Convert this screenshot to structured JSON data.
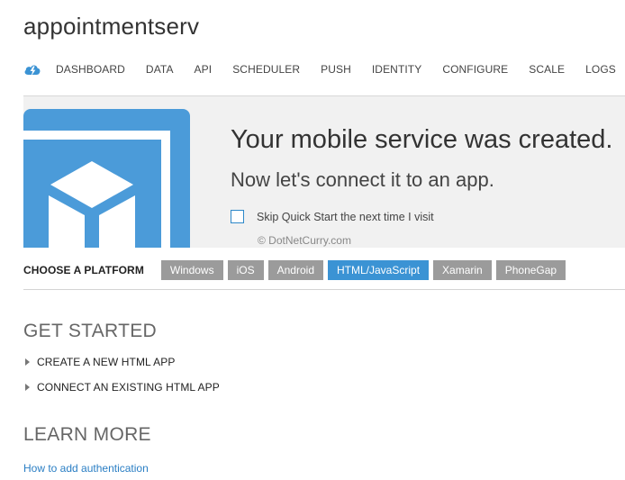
{
  "app": {
    "title": "appointmentserv"
  },
  "nav": {
    "items": [
      "DASHBOARD",
      "DATA",
      "API",
      "SCHEDULER",
      "PUSH",
      "IDENTITY",
      "CONFIGURE",
      "SCALE",
      "LOGS"
    ]
  },
  "banner": {
    "title": "Your mobile service was created.",
    "subtitle": "Now let's connect it to an app.",
    "skip_label": "Skip Quick Start the next time I visit",
    "skip_checked": false,
    "watermark": "© DotNetCurry.com"
  },
  "platform": {
    "label": "CHOOSE A PLATFORM",
    "options": [
      "Windows",
      "iOS",
      "Android",
      "HTML/JavaScript",
      "Xamarin",
      "PhoneGap"
    ],
    "selected": "HTML/JavaScript"
  },
  "get_started": {
    "heading": "GET STARTED",
    "items": [
      "CREATE A NEW HTML APP",
      "CONNECT AN EXISTING HTML APP"
    ]
  },
  "learn_more": {
    "heading": "LEARN MORE",
    "link": "How to add authentication"
  },
  "colors": {
    "accent": "#3b93d4",
    "button_gray": "#9b9b9b",
    "link": "#2a7ec4"
  },
  "icons": {
    "nav": "cloud-lightning-icon",
    "banner": "mobile-cube-icon",
    "expander": "triangle-right-icon"
  }
}
